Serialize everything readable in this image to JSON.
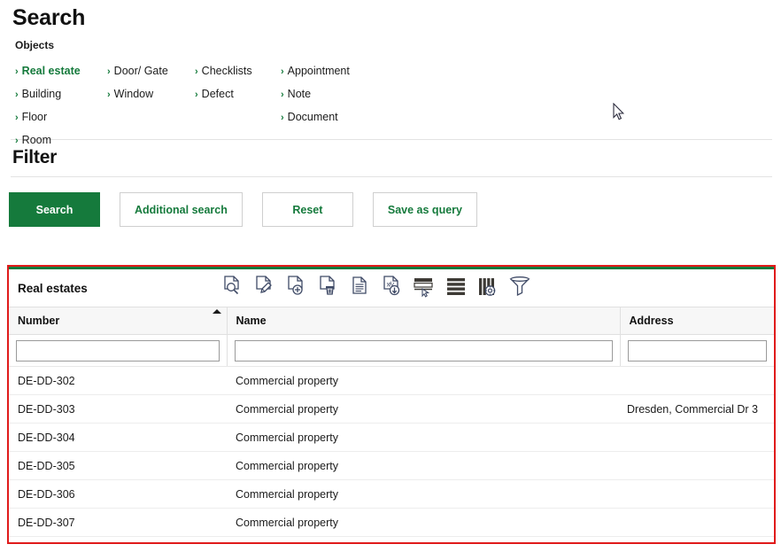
{
  "page": {
    "title": "Search",
    "objects_label": "Objects"
  },
  "objects": {
    "columns": [
      [
        {
          "label": "Real estate",
          "active": true
        },
        {
          "label": "Building",
          "active": false
        },
        {
          "label": "Floor",
          "active": false
        },
        {
          "label": "Room",
          "active": false
        }
      ],
      [
        {
          "label": "Door/ Gate",
          "active": false
        },
        {
          "label": "Window",
          "active": false
        }
      ],
      [
        {
          "label": "Checklists",
          "active": false
        },
        {
          "label": "Defect",
          "active": false
        }
      ],
      [
        {
          "label": "Appointment",
          "active": false
        },
        {
          "label": "Note",
          "active": false
        },
        {
          "label": "Document",
          "active": false
        }
      ]
    ]
  },
  "filter": {
    "title": "Filter",
    "buttons": [
      {
        "label": "Search",
        "style": "primary"
      },
      {
        "label": "Additional search",
        "style": "secondary"
      },
      {
        "label": "Reset",
        "style": "secondary"
      },
      {
        "label": "Save as query",
        "style": "secondary"
      }
    ]
  },
  "results": {
    "title": "Real estates",
    "toolbar_icons": [
      "document-search-icon",
      "document-edit-icon",
      "document-add-icon",
      "document-delete-icon",
      "document-report-icon",
      "document-export-download-icon",
      "row-select-icon",
      "rows-layout-icon",
      "columns-settings-icon",
      "filter-funnel-icon"
    ],
    "columns": [
      {
        "label": "Number",
        "sorted": "asc",
        "filter_value": ""
      },
      {
        "label": "Name",
        "sorted": "",
        "filter_value": ""
      },
      {
        "label": "Address",
        "sorted": "",
        "filter_value": ""
      }
    ],
    "filter_placeholder": "",
    "rows": [
      {
        "number": "DE-DD-302",
        "name": "Commercial property",
        "address": ""
      },
      {
        "number": "DE-DD-303",
        "name": "Commercial property",
        "address": "Dresden, Commercial Dr 3"
      },
      {
        "number": "DE-DD-304",
        "name": "Commercial property",
        "address": ""
      },
      {
        "number": "DE-DD-305",
        "name": "Commercial property",
        "address": ""
      },
      {
        "number": "DE-DD-306",
        "name": "Commercial property",
        "address": ""
      },
      {
        "number": "DE-DD-307",
        "name": "Commercial property",
        "address": ""
      }
    ]
  },
  "colors": {
    "accent_green": "#157a3c",
    "highlight_border": "#e01b1b",
    "icon_stroke": "#3f4a66",
    "icon_fill_dark": "#3d3a35"
  }
}
